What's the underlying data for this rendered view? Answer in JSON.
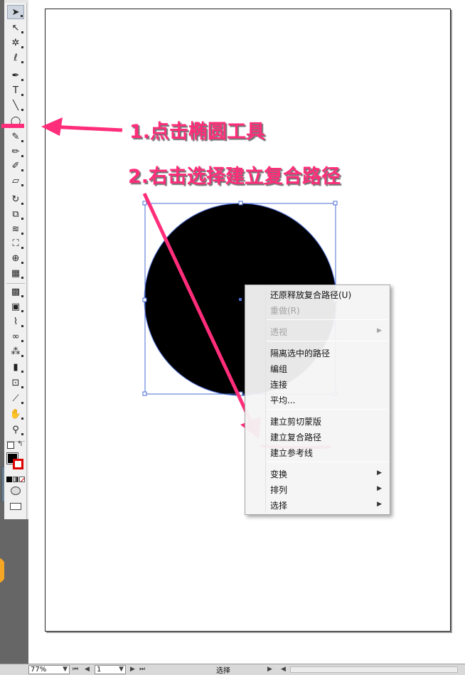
{
  "tools": [
    {
      "name": "selection-tool-icon",
      "glyph": "➤"
    },
    {
      "name": "direct-selection-tool-icon",
      "glyph": "↖"
    },
    {
      "name": "magic-wand-tool-icon",
      "glyph": "✲"
    },
    {
      "name": "lasso-tool-icon",
      "glyph": "ℓ"
    },
    {
      "name": "pen-tool-icon",
      "glyph": "✒"
    },
    {
      "name": "type-tool-icon",
      "glyph": "T"
    },
    {
      "name": "line-segment-tool-icon",
      "glyph": "╲"
    },
    {
      "name": "ellipse-tool-icon",
      "glyph": "◯"
    },
    {
      "name": "paintbrush-tool-icon",
      "glyph": "✎"
    },
    {
      "name": "pencil-tool-icon",
      "glyph": "✏"
    },
    {
      "name": "blob-brush-tool-icon",
      "glyph": "✐"
    },
    {
      "name": "eraser-tool-icon",
      "glyph": "▱"
    },
    {
      "name": "rotate-tool-icon",
      "glyph": "↻"
    },
    {
      "name": "scale-tool-icon",
      "glyph": "⧉"
    },
    {
      "name": "warp-tool-icon",
      "glyph": "≋"
    },
    {
      "name": "free-transform-tool-icon",
      "glyph": "⛶"
    },
    {
      "name": "shape-builder-tool-icon",
      "glyph": "⊕"
    },
    {
      "name": "perspective-grid-tool-icon",
      "glyph": "▦"
    },
    {
      "name": "mesh-tool-icon",
      "glyph": "▩"
    },
    {
      "name": "gradient-tool-icon",
      "glyph": "▣"
    },
    {
      "name": "eyedropper-tool-icon",
      "glyph": "⌇"
    },
    {
      "name": "blend-tool-icon",
      "glyph": "∞"
    },
    {
      "name": "symbol-sprayer-tool-icon",
      "glyph": "⁂"
    },
    {
      "name": "column-graph-tool-icon",
      "glyph": "▮"
    },
    {
      "name": "artboard-tool-icon",
      "glyph": "⊡"
    },
    {
      "name": "slice-tool-icon",
      "glyph": "⟋"
    },
    {
      "name": "hand-tool-icon",
      "glyph": "✋"
    },
    {
      "name": "zoom-tool-icon",
      "glyph": "⚲"
    }
  ],
  "annotations": {
    "step1": "1.点击椭圆工具",
    "step2": "2.右击选择建立复合路径"
  },
  "context_menu": {
    "items": [
      {
        "label": "还原释放复合路径(U)",
        "enabled": true,
        "submenu": false
      },
      {
        "label": "重做(R)",
        "enabled": false,
        "submenu": false
      },
      {
        "label": "透视",
        "enabled": false,
        "submenu": true
      },
      {
        "label": "隔离选中的路径",
        "enabled": true,
        "submenu": false
      },
      {
        "label": "编组",
        "enabled": true,
        "submenu": false
      },
      {
        "label": "连接",
        "enabled": true,
        "submenu": false
      },
      {
        "label": "平均...",
        "enabled": true,
        "submenu": false
      },
      {
        "label": "建立剪切蒙版",
        "enabled": true,
        "submenu": false
      },
      {
        "label": "建立复合路径",
        "enabled": true,
        "submenu": false
      },
      {
        "label": "建立参考线",
        "enabled": true,
        "submenu": false
      },
      {
        "label": "变换",
        "enabled": true,
        "submenu": true
      },
      {
        "label": "排列",
        "enabled": true,
        "submenu": true
      },
      {
        "label": "选择",
        "enabled": true,
        "submenu": true
      }
    ]
  },
  "status_bar": {
    "zoom": "77%",
    "page": "1",
    "tool_label": "选择"
  },
  "colors": {
    "annotation": "#ff2d7a",
    "circle_fill": "#000000",
    "selection": "#4a6cd4"
  }
}
